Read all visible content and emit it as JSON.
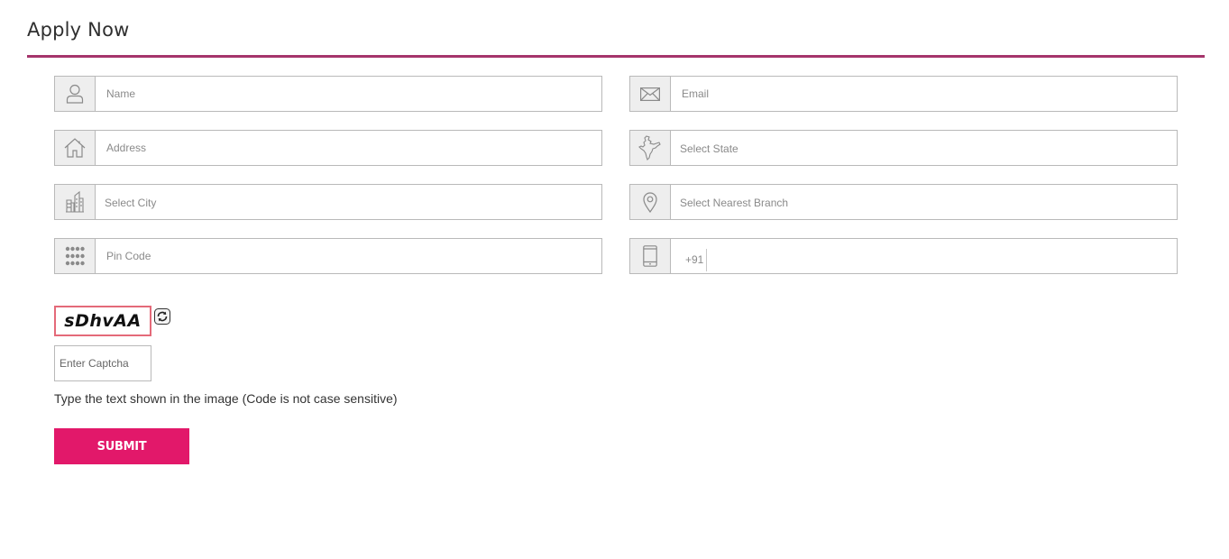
{
  "heading": "Apply Now",
  "colors": {
    "accent_rule": "#a5346b",
    "submit_bg": "#e2186a",
    "captcha_border": "#e46a79"
  },
  "form": {
    "name": {
      "placeholder": "Name",
      "icon": "user-icon"
    },
    "email": {
      "placeholder": "Email",
      "icon": "envelope-icon"
    },
    "address": {
      "placeholder": "Address",
      "icon": "home-icon"
    },
    "state": {
      "placeholder": "Select State",
      "icon": "india-map-icon"
    },
    "city": {
      "placeholder": "Select City",
      "icon": "city-buildings-icon"
    },
    "branch": {
      "placeholder": "Select Nearest Branch",
      "icon": "location-pin-icon"
    },
    "pincode": {
      "placeholder": "Pin Code",
      "icon": "keypad-icon"
    },
    "mobile": {
      "prefix": "+91",
      "icon": "mobile-phone-icon"
    }
  },
  "captcha": {
    "code": "sDhvAA",
    "placeholder": "Enter Captcha",
    "hint": "Type the text shown in the image (Code is not case sensitive)",
    "refresh_icon": "refresh-icon"
  },
  "submit_label": "SUBMIT"
}
